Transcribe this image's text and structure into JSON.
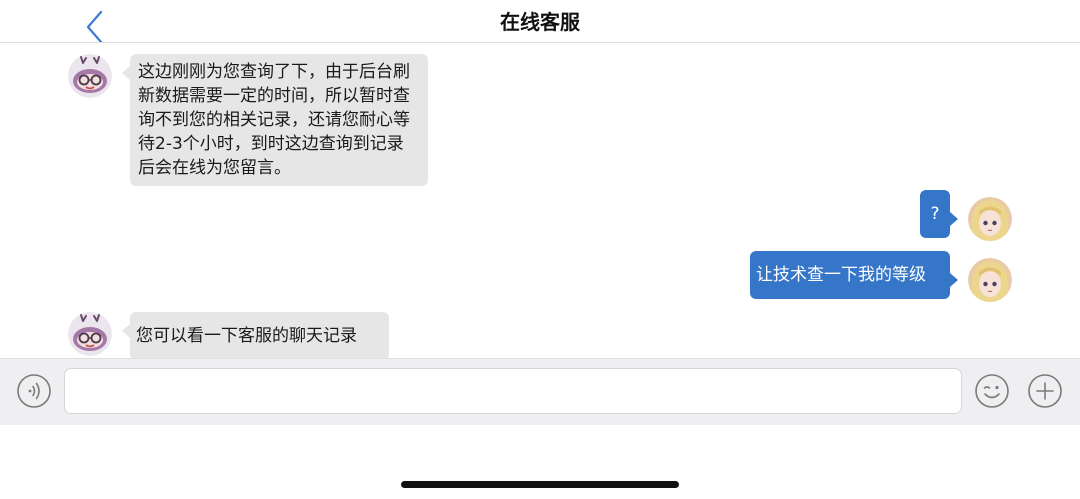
{
  "nav": {
    "title": "在线客服",
    "back_icon": "chevron-left-icon"
  },
  "messages": [
    {
      "side": "incoming",
      "sender": "agent",
      "avatar_icon": "reindeer-mascot-avatar",
      "text": "这边刚刚为您查询了下，由于后台刷新数据需要一定的时间，所以暂时查询不到您的相关记录，还请您耐心等待2-3个小时，到时这边查询到记录后会在线为您留言。"
    },
    {
      "side": "outgoing",
      "sender": "user",
      "avatar_icon": "anime-girl-avatar",
      "text": "?"
    },
    {
      "side": "outgoing",
      "sender": "user",
      "avatar_icon": "anime-girl-avatar",
      "text": "让技术查一下我的等级"
    },
    {
      "side": "incoming",
      "sender": "agent",
      "avatar_icon": "reindeer-mascot-avatar",
      "text": "您可以看一下客服的聊天记录"
    }
  ],
  "input": {
    "value": "",
    "placeholder": "",
    "voice_icon": "voice-icon",
    "emoji_icon": "emoji-icon",
    "plus_icon": "plus-icon"
  },
  "colors": {
    "outgoing_bubble": "#3676c8",
    "incoming_bubble": "#e6e6e6",
    "back_icon": "#3a7bd5"
  }
}
